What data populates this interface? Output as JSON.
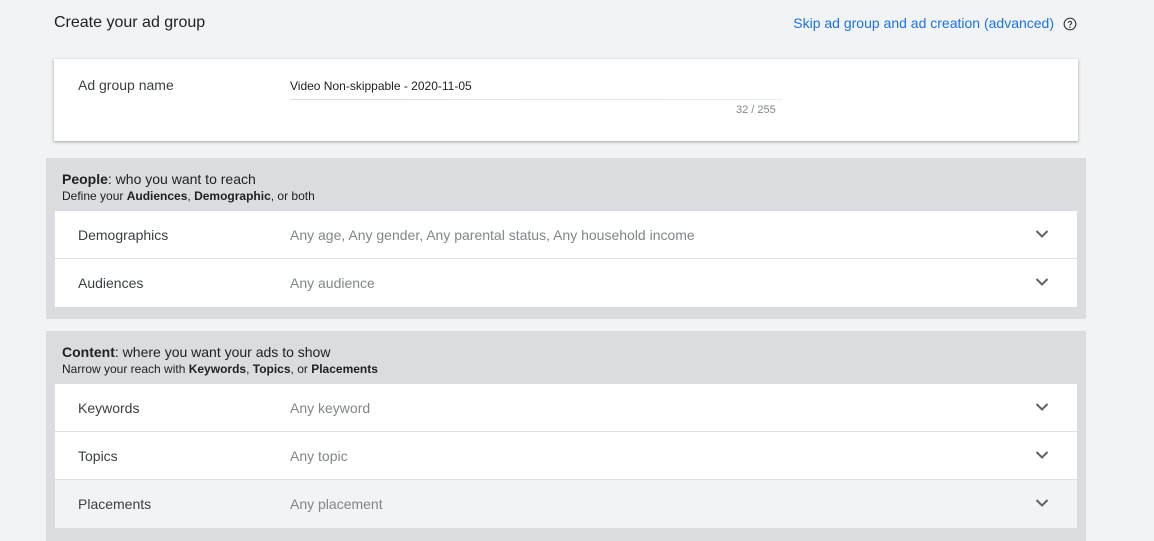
{
  "header": {
    "title": "Create your ad group",
    "skip_link": "Skip ad group and ad creation (advanced)",
    "help_icon": "help-circle-icon"
  },
  "ad_group": {
    "label": "Ad group name",
    "value": "Video Non-skippable - 2020-11-05",
    "char_count": "32 / 255"
  },
  "people": {
    "title_bold": "People",
    "title_rest": ": who you want to reach",
    "sub_prefix": "Define your ",
    "sub_b1": "Audiences",
    "sub_mid": ", ",
    "sub_b2": "Demographic",
    "sub_suffix": ", or both",
    "rows": [
      {
        "label": "Demographics",
        "value": "Any age, Any gender, Any parental status, Any household income"
      },
      {
        "label": "Audiences",
        "value": "Any audience"
      }
    ]
  },
  "content": {
    "title_bold": "Content",
    "title_rest": ": where you want your ads to show",
    "sub_prefix": "Narrow your reach with ",
    "sub_b1": "Keywords",
    "sub_mid": ", ",
    "sub_b2": "Topics",
    "sub_mid2": ", or ",
    "sub_b3": "Placements",
    "rows": [
      {
        "label": "Keywords",
        "value": "Any keyword"
      },
      {
        "label": "Topics",
        "value": "Any topic"
      },
      {
        "label": "Placements",
        "value": "Any placement"
      }
    ]
  },
  "icons": {
    "expand": "chevron-down-icon"
  },
  "colors": {
    "link": "#1a73e8",
    "section_bg": "#dadce0",
    "page_bg": "#f1f3f4"
  }
}
